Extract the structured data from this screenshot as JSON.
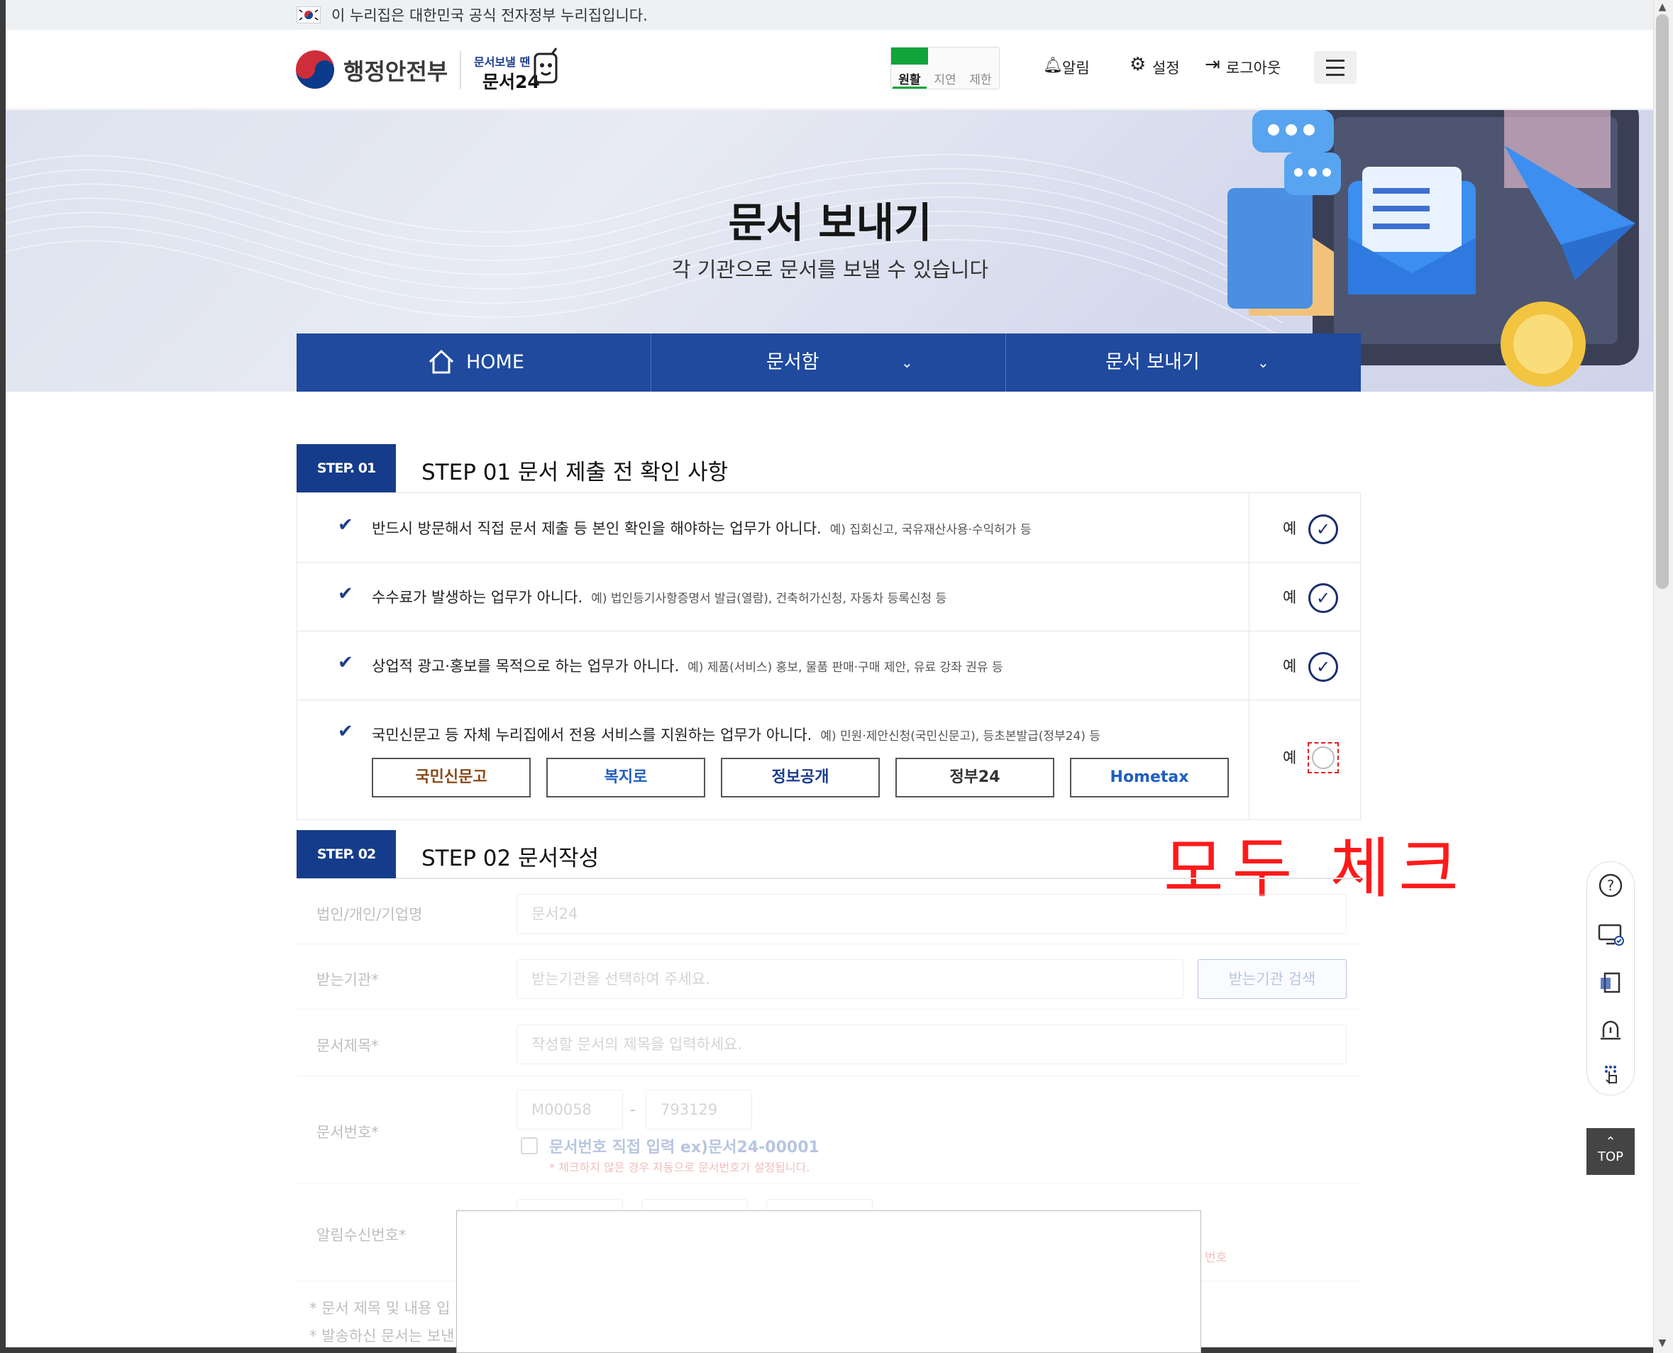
{
  "gov_banner": {
    "text": "이 누리집은 대한민국 공식 전자정부 누리집입니다."
  },
  "header": {
    "ministry_name": "행정안전부",
    "service_small": "문서보낼 땐",
    "service_name": "문서24",
    "traffic": [
      "원활",
      "지연",
      "제한"
    ],
    "links": {
      "alarm": "알림",
      "settings": "설정",
      "logout": "로그아웃"
    }
  },
  "hero": {
    "title": "문서 보내기",
    "subtitle": "각 기관으로 문서를 보낼 수 있습니다"
  },
  "nav": {
    "home": "HOME",
    "docbox": "문서함",
    "send": "문서 보내기"
  },
  "step1": {
    "tag": "STEP. 01",
    "title": "STEP 01 문서 제출 전 확인 사항",
    "yes_label": "예",
    "rows": [
      {
        "main": "반드시 방문해서 직접 문서 제출 등 본인 확인을 해야하는 업무가 아니다.",
        "example": "예) 집회신고, 국유재산사용·수익허가 등",
        "checked": true
      },
      {
        "main": "수수료가 발생하는 업무가 아니다.",
        "example": "예) 법인등기사항증명서 발급(열람), 건축허가신청, 자동차 등록신청 등",
        "checked": true
      },
      {
        "main": "상업적 광고·홍보를 목적으로 하는 업무가 아니다.",
        "example": "예) 제품(서비스) 홍보, 물품 판매·구매 제안, 유료 강좌 권유 등",
        "checked": true
      },
      {
        "main": "국민신문고 등 자체 누리집에서 전용 서비스를 지원하는 업무가 아니다.",
        "example": "예) 민원·제안신청(국민신문고), 등초본발급(정부24) 등",
        "checked": false
      }
    ],
    "services": [
      "국민신문고",
      "복지로",
      "정보공개",
      "정부24",
      "Hometax"
    ]
  },
  "annotation": "모두  체크",
  "step2": {
    "tag": "STEP. 02",
    "title": "STEP 02 문서작성",
    "fields": {
      "org_label": "법인/개인/기업명",
      "org_value": "문서24",
      "recv_label": "받는기관*",
      "recv_placeholder": "받는기관을 선택하여 주세요.",
      "recv_button": "받는기관 검색",
      "title_label": "문서제목*",
      "title_placeholder": "작성할 문서의 제목을 입력하세요.",
      "num_label": "문서번호*",
      "num_prefix": "M00058",
      "num_dash": "-",
      "num_suffix": "793129",
      "num_direct": "문서번호 직접 입력 ex)문서24-00001",
      "num_note": "* 체크하지 않은 경우 자동으로 문서번호가 설정됩니다.",
      "alert_label": "알림수신번호*",
      "alert_trailing": "번호"
    },
    "notes": [
      "* 문서 제목 및 내용 입",
      "* 발송하신 문서는 보낸"
    ]
  },
  "quick_menu": {
    "top": "TOP"
  },
  "colors": {
    "nav": "#1f4a9e",
    "step_tag": "#153c8a",
    "traffic_green": "#12a33c",
    "annotation": "#ff1a1a"
  }
}
